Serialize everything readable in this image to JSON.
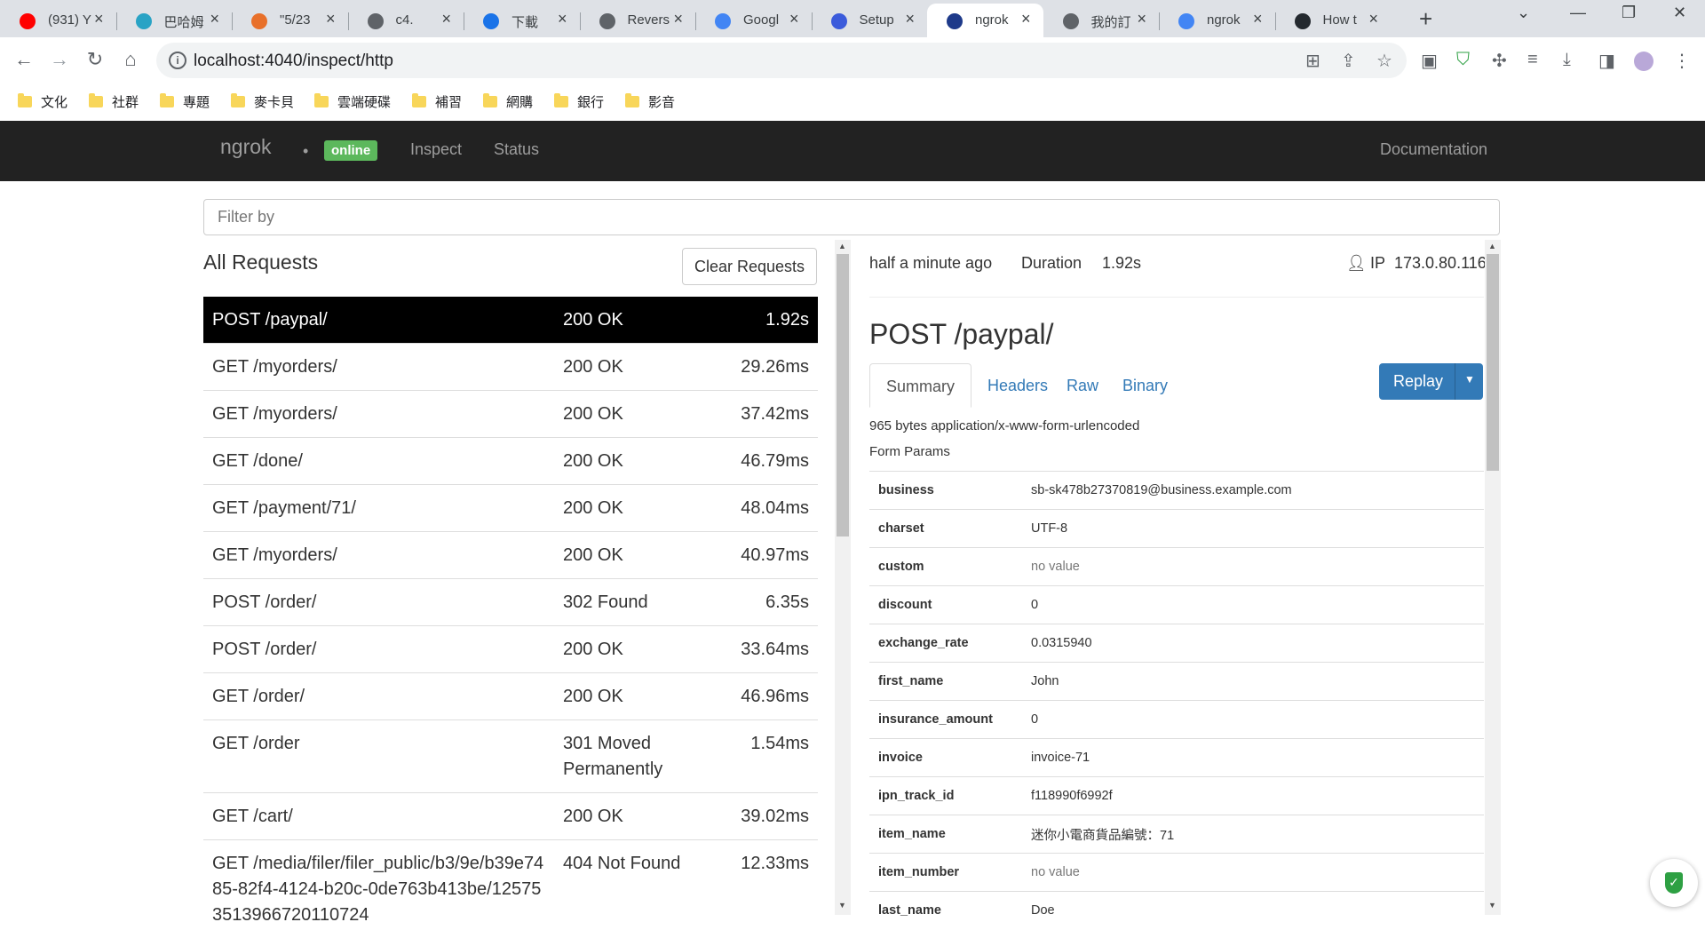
{
  "browser": {
    "tabs": [
      {
        "title": "(931) Y",
        "color": "#ff0000"
      },
      {
        "title": "巴哈姆",
        "color": "#29a3c5"
      },
      {
        "title": "\"5/23",
        "color": "#e8702a"
      },
      {
        "title": "c4.",
        "color": "#5f6368"
      },
      {
        "title": "下載",
        "color": "#1a73e8"
      },
      {
        "title": "Revers",
        "color": "#5f6368"
      },
      {
        "title": "Googl",
        "color": "#4285f4"
      },
      {
        "title": "Setup",
        "color": "#3b5bdb"
      },
      {
        "title": "ngrok",
        "color": "#1e3a8a"
      },
      {
        "title": "我的訂",
        "color": "#5f6368"
      },
      {
        "title": "ngrok",
        "color": "#4285f4"
      },
      {
        "title": "How t",
        "color": "#24292f"
      }
    ],
    "url": "localhost:4040/inspect/http",
    "bookmarks": [
      "文化",
      "社群",
      "專題",
      "麥卡貝",
      "雲端硬碟",
      "補習",
      "網購",
      "銀行",
      "影音"
    ]
  },
  "app": {
    "brand": "ngrok",
    "status_badge": "online",
    "nav": {
      "inspect": "Inspect",
      "status": "Status",
      "documentation": "Documentation"
    },
    "filter_placeholder": "Filter by",
    "requests_title": "All Requests",
    "clear_label": "Clear Requests",
    "requests": [
      {
        "path": "POST /paypal/",
        "status": "200 OK",
        "duration": "1.92s"
      },
      {
        "path": "GET /myorders/",
        "status": "200 OK",
        "duration": "29.26ms"
      },
      {
        "path": "GET /myorders/",
        "status": "200 OK",
        "duration": "37.42ms"
      },
      {
        "path": "GET /done/",
        "status": "200 OK",
        "duration": "46.79ms"
      },
      {
        "path": "GET /payment/71/",
        "status": "200 OK",
        "duration": "48.04ms"
      },
      {
        "path": "GET /myorders/",
        "status": "200 OK",
        "duration": "40.97ms"
      },
      {
        "path": "POST /order/",
        "status": "302 Found",
        "duration": "6.35s"
      },
      {
        "path": "POST /order/",
        "status": "200 OK",
        "duration": "33.64ms"
      },
      {
        "path": "GET /order/",
        "status": "200 OK",
        "duration": "46.96ms"
      },
      {
        "path": "GET /order",
        "status": "301 Moved Permanently",
        "duration": "1.54ms"
      },
      {
        "path": "GET /cart/",
        "status": "200 OK",
        "duration": "39.02ms"
      },
      {
        "path": "GET /media/filer/filer_public/b3/9e/b39e7485-82f4-4124-b20c-0de763b413be/125753513966720110724",
        "status": "404 Not Found",
        "duration": "12.33ms"
      }
    ],
    "detail": {
      "time_ago": "half a minute ago",
      "duration_label": "Duration",
      "duration_value": "1.92s",
      "ip_label": "IP",
      "ip_value": "173.0.80.116",
      "title": "POST /paypal/",
      "tabs": [
        "Summary",
        "Headers",
        "Raw",
        "Binary"
      ],
      "replay_label": "Replay",
      "content_info": "965 bytes application/x-www-form-urlencoded",
      "form_params_label": "Form Params",
      "params": [
        {
          "key": "business",
          "value": "sb-sk478b27370819@business.example.com",
          "empty": false
        },
        {
          "key": "charset",
          "value": "UTF-8",
          "empty": false
        },
        {
          "key": "custom",
          "value": "no value",
          "empty": true
        },
        {
          "key": "discount",
          "value": "0",
          "empty": false
        },
        {
          "key": "exchange_rate",
          "value": "0.0315940",
          "empty": false
        },
        {
          "key": "first_name",
          "value": "John",
          "empty": false
        },
        {
          "key": "insurance_amount",
          "value": "0",
          "empty": false
        },
        {
          "key": "invoice",
          "value": "invoice-71",
          "empty": false
        },
        {
          "key": "ipn_track_id",
          "value": "f118990f6992f",
          "empty": false
        },
        {
          "key": "item_name",
          "value": "迷你小電商貨品編號：71",
          "empty": false
        },
        {
          "key": "item_number",
          "value": "no value",
          "empty": true
        },
        {
          "key": "last_name",
          "value": "Doe",
          "empty": false
        }
      ]
    }
  }
}
